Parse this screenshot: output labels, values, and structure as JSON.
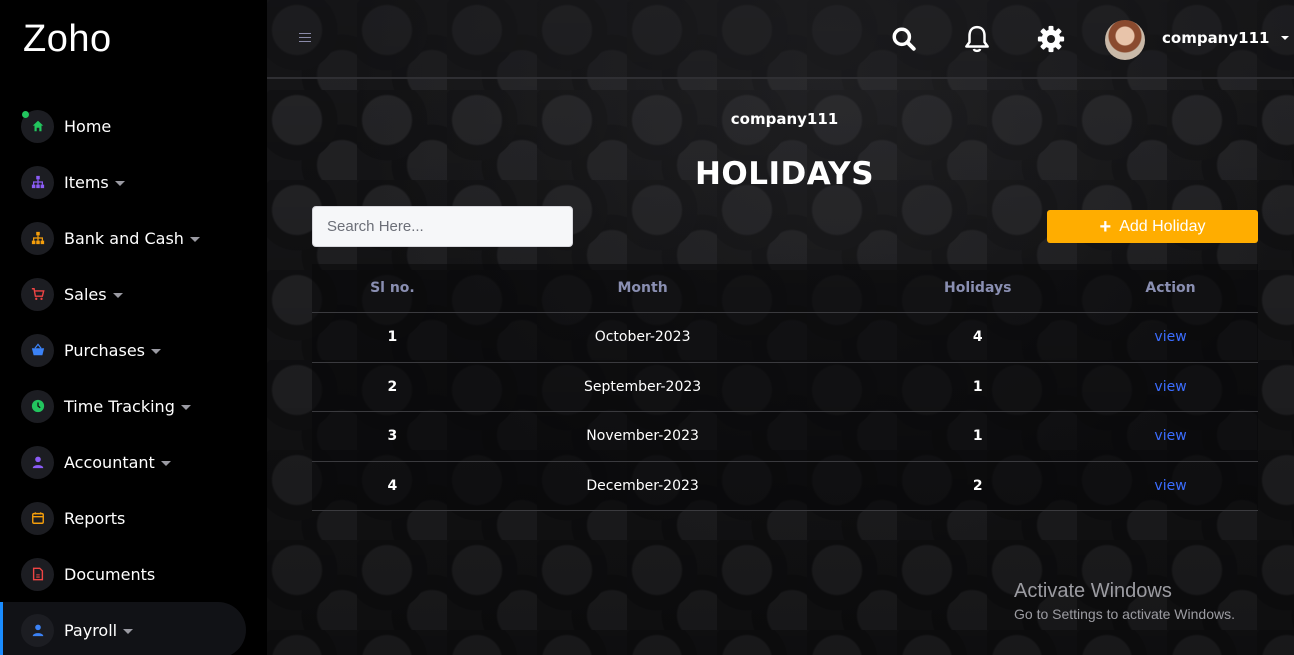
{
  "brand": "Zoho",
  "sidebar": {
    "items": [
      {
        "label": "Home",
        "icon": "home-icon",
        "color": "#22c55e"
      },
      {
        "label": "Items",
        "icon": "sitemap-icon",
        "color": "#8b5cf6",
        "dropdown": true
      },
      {
        "label": "Bank and Cash",
        "icon": "sitemap-icon",
        "color": "#f59e0b",
        "dropdown": true
      },
      {
        "label": "Sales",
        "icon": "cart-icon",
        "color": "#ef4444",
        "dropdown": true
      },
      {
        "label": "Purchases",
        "icon": "basket-icon",
        "color": "#3b82f6",
        "dropdown": true
      },
      {
        "label": "Time Tracking",
        "icon": "clock-icon",
        "color": "#22c55e",
        "dropdown": true
      },
      {
        "label": "Accountant",
        "icon": "user-icon",
        "color": "#8b5cf6",
        "dropdown": true
      },
      {
        "label": "Reports",
        "icon": "calendar-icon",
        "color": "#f59e0b"
      },
      {
        "label": "Documents",
        "icon": "document-icon",
        "color": "#ef4444"
      },
      {
        "label": "Payroll",
        "icon": "user-icon",
        "color": "#3b82f6",
        "dropdown": true,
        "active": true
      }
    ]
  },
  "header": {
    "username": "company111",
    "icons": [
      "search-icon",
      "bell-icon",
      "gear-icon"
    ]
  },
  "main": {
    "company": "company111",
    "title": "HOLIDAYS",
    "search_placeholder": "Search Here...",
    "add_button_label": "Add Holiday"
  },
  "table": {
    "columns": [
      "Sl no.",
      "Month",
      "Holidays",
      "Action"
    ],
    "rows": [
      {
        "sl": "1",
        "month": "October-2023",
        "holidays": "4",
        "action": "view"
      },
      {
        "sl": "2",
        "month": "September-2023",
        "holidays": "1",
        "action": "view"
      },
      {
        "sl": "3",
        "month": "November-2023",
        "holidays": "1",
        "action": "view"
      },
      {
        "sl": "4",
        "month": "December-2023",
        "holidays": "2",
        "action": "view"
      }
    ]
  },
  "watermark": {
    "line1": "Activate Windows",
    "line2": "Go to Settings to activate Windows."
  },
  "colors": {
    "accent": "#ffad00",
    "link": "#3b6dff",
    "header_text": "#8a8fb2",
    "active_border": "#1a8cff"
  }
}
